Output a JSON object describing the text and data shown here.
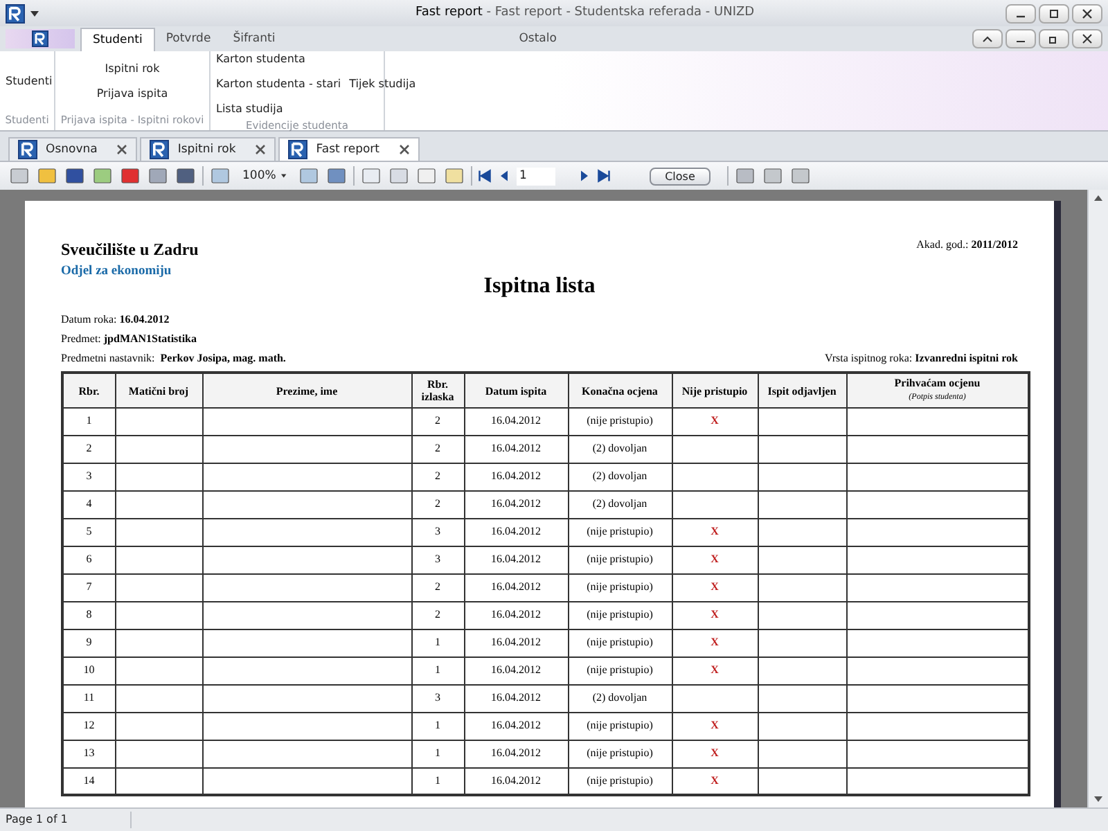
{
  "window": {
    "title_main": "Fast report",
    "title_rest": " - Fast report - Studentska referada - UNIZD"
  },
  "ribbon_tabs": [
    {
      "label": "Studenti",
      "selected": true
    },
    {
      "label": "Potvrde",
      "selected": false
    },
    {
      "label": "Šifranti",
      "selected": false
    },
    {
      "label": "Ostalo",
      "selected": false
    }
  ],
  "ribbon_groups": [
    {
      "caption": "Studenti",
      "items": [
        [
          "Studenti"
        ]
      ]
    },
    {
      "caption": "Prijava ispita - Ispitni rokovi",
      "items": [
        [
          "Ispitni rok"
        ],
        [
          "Prijava ispita"
        ]
      ]
    },
    {
      "caption": "Evidencije studenta",
      "items": [
        [
          "Karton studenta"
        ],
        [
          "Karton studenta - stari",
          "Tijek studija"
        ],
        [
          "Lista studija"
        ]
      ]
    }
  ],
  "doc_tabs": [
    {
      "label": "Osnovna",
      "selected": false
    },
    {
      "label": "Ispitni rok",
      "selected": false
    },
    {
      "label": "Fast report",
      "selected": true
    }
  ],
  "toolbar": {
    "zoom": "100%",
    "page": "1",
    "close": "Close"
  },
  "report": {
    "university": "Sveučilište u Zadru",
    "department": "Odjel za ekonomiju",
    "academic_year_label": "Akad. god.:",
    "academic_year": "2011/2012",
    "title": "Ispitna lista",
    "date_label": "Datum roka:",
    "date": "16.04.2012",
    "subject_label": "Predmet:",
    "subject": "jpdMAN1Statistika",
    "teacher_label": "Predmetni nastavnik:",
    "teacher": "Perkov Josipa, mag. math.",
    "term_label": "Vrsta ispitnog roka:",
    "term": "Izvanredni ispitni rok",
    "columns": [
      "Rbr.",
      "Matični broj",
      "Prezime, ime",
      "Rbr. izlaska",
      "Datum ispita",
      "Konačna ocjena",
      "Nije pristupio",
      "Ispit odjavljen",
      "Prihvaćam ocjenu"
    ],
    "column_note": "(Potpis studenta)",
    "rows": [
      {
        "no": "1",
        "attempt": "2",
        "date": "16.04.2012",
        "grade": "(nije pristupio)",
        "absent_mark": "X"
      },
      {
        "no": "2",
        "attempt": "2",
        "date": "16.04.2012",
        "grade": "(2) dovoljan"
      },
      {
        "no": "3",
        "attempt": "2",
        "date": "16.04.2012",
        "grade": "(2) dovoljan"
      },
      {
        "no": "4",
        "attempt": "2",
        "date": "16.04.2012",
        "grade": "(2) dovoljan"
      },
      {
        "no": "5",
        "attempt": "3",
        "date": "16.04.2012",
        "grade": "(nije pristupio)",
        "absent_mark": "X"
      },
      {
        "no": "6",
        "attempt": "3",
        "date": "16.04.2012",
        "grade": "(nije pristupio)",
        "absent_mark": "X"
      },
      {
        "no": "7",
        "attempt": "2",
        "date": "16.04.2012",
        "grade": "(nije pristupio)",
        "absent_mark": "X"
      },
      {
        "no": "8",
        "attempt": "2",
        "date": "16.04.2012",
        "grade": "(nije pristupio)",
        "absent_mark": "X"
      },
      {
        "no": "9",
        "attempt": "1",
        "date": "16.04.2012",
        "grade": "(nije pristupio)",
        "absent_mark": "X"
      },
      {
        "no": "10",
        "attempt": "1",
        "date": "16.04.2012",
        "grade": "(nije pristupio)",
        "absent_mark": "X"
      },
      {
        "no": "11",
        "attempt": "3",
        "date": "16.04.2012",
        "grade": "(2) dovoljan"
      },
      {
        "no": "12",
        "attempt": "1",
        "date": "16.04.2012",
        "grade": "(nije pristupio)",
        "absent_mark": "X"
      },
      {
        "no": "13",
        "attempt": "1",
        "date": "16.04.2012",
        "grade": "(nije pristupio)",
        "absent_mark": "X"
      },
      {
        "no": "14",
        "attempt": "1",
        "date": "16.04.2012",
        "grade": "(nije pristupio)",
        "absent_mark": "X"
      }
    ]
  },
  "status_bar": "Page 1 of 1"
}
